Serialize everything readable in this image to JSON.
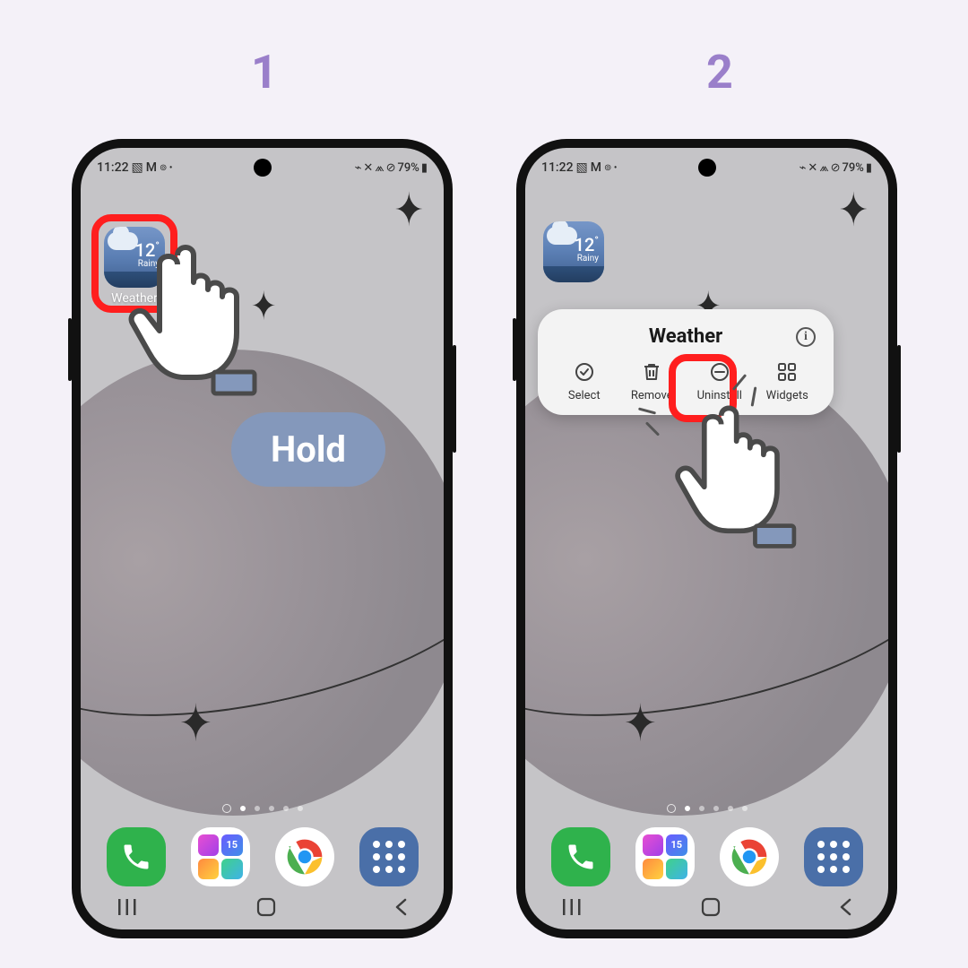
{
  "steps": {
    "one": "1",
    "two": "2"
  },
  "statusbar": {
    "time": "11:22",
    "battery": "79%"
  },
  "weather": {
    "temp": "12",
    "unit": "°",
    "condition": "Rainy",
    "label": "Weather"
  },
  "hold_label": "Hold",
  "popup": {
    "title": "Weather",
    "actions": {
      "select": "Select",
      "remove": "Remove",
      "uninstall": "Uninstall",
      "widgets": "Widgets"
    }
  },
  "dock": {
    "phone": "Phone",
    "gallery": "Gallery",
    "chrome": "Chrome",
    "apps": "Apps"
  },
  "nav": {
    "recents": "|||",
    "home": "○",
    "back": "‹"
  }
}
